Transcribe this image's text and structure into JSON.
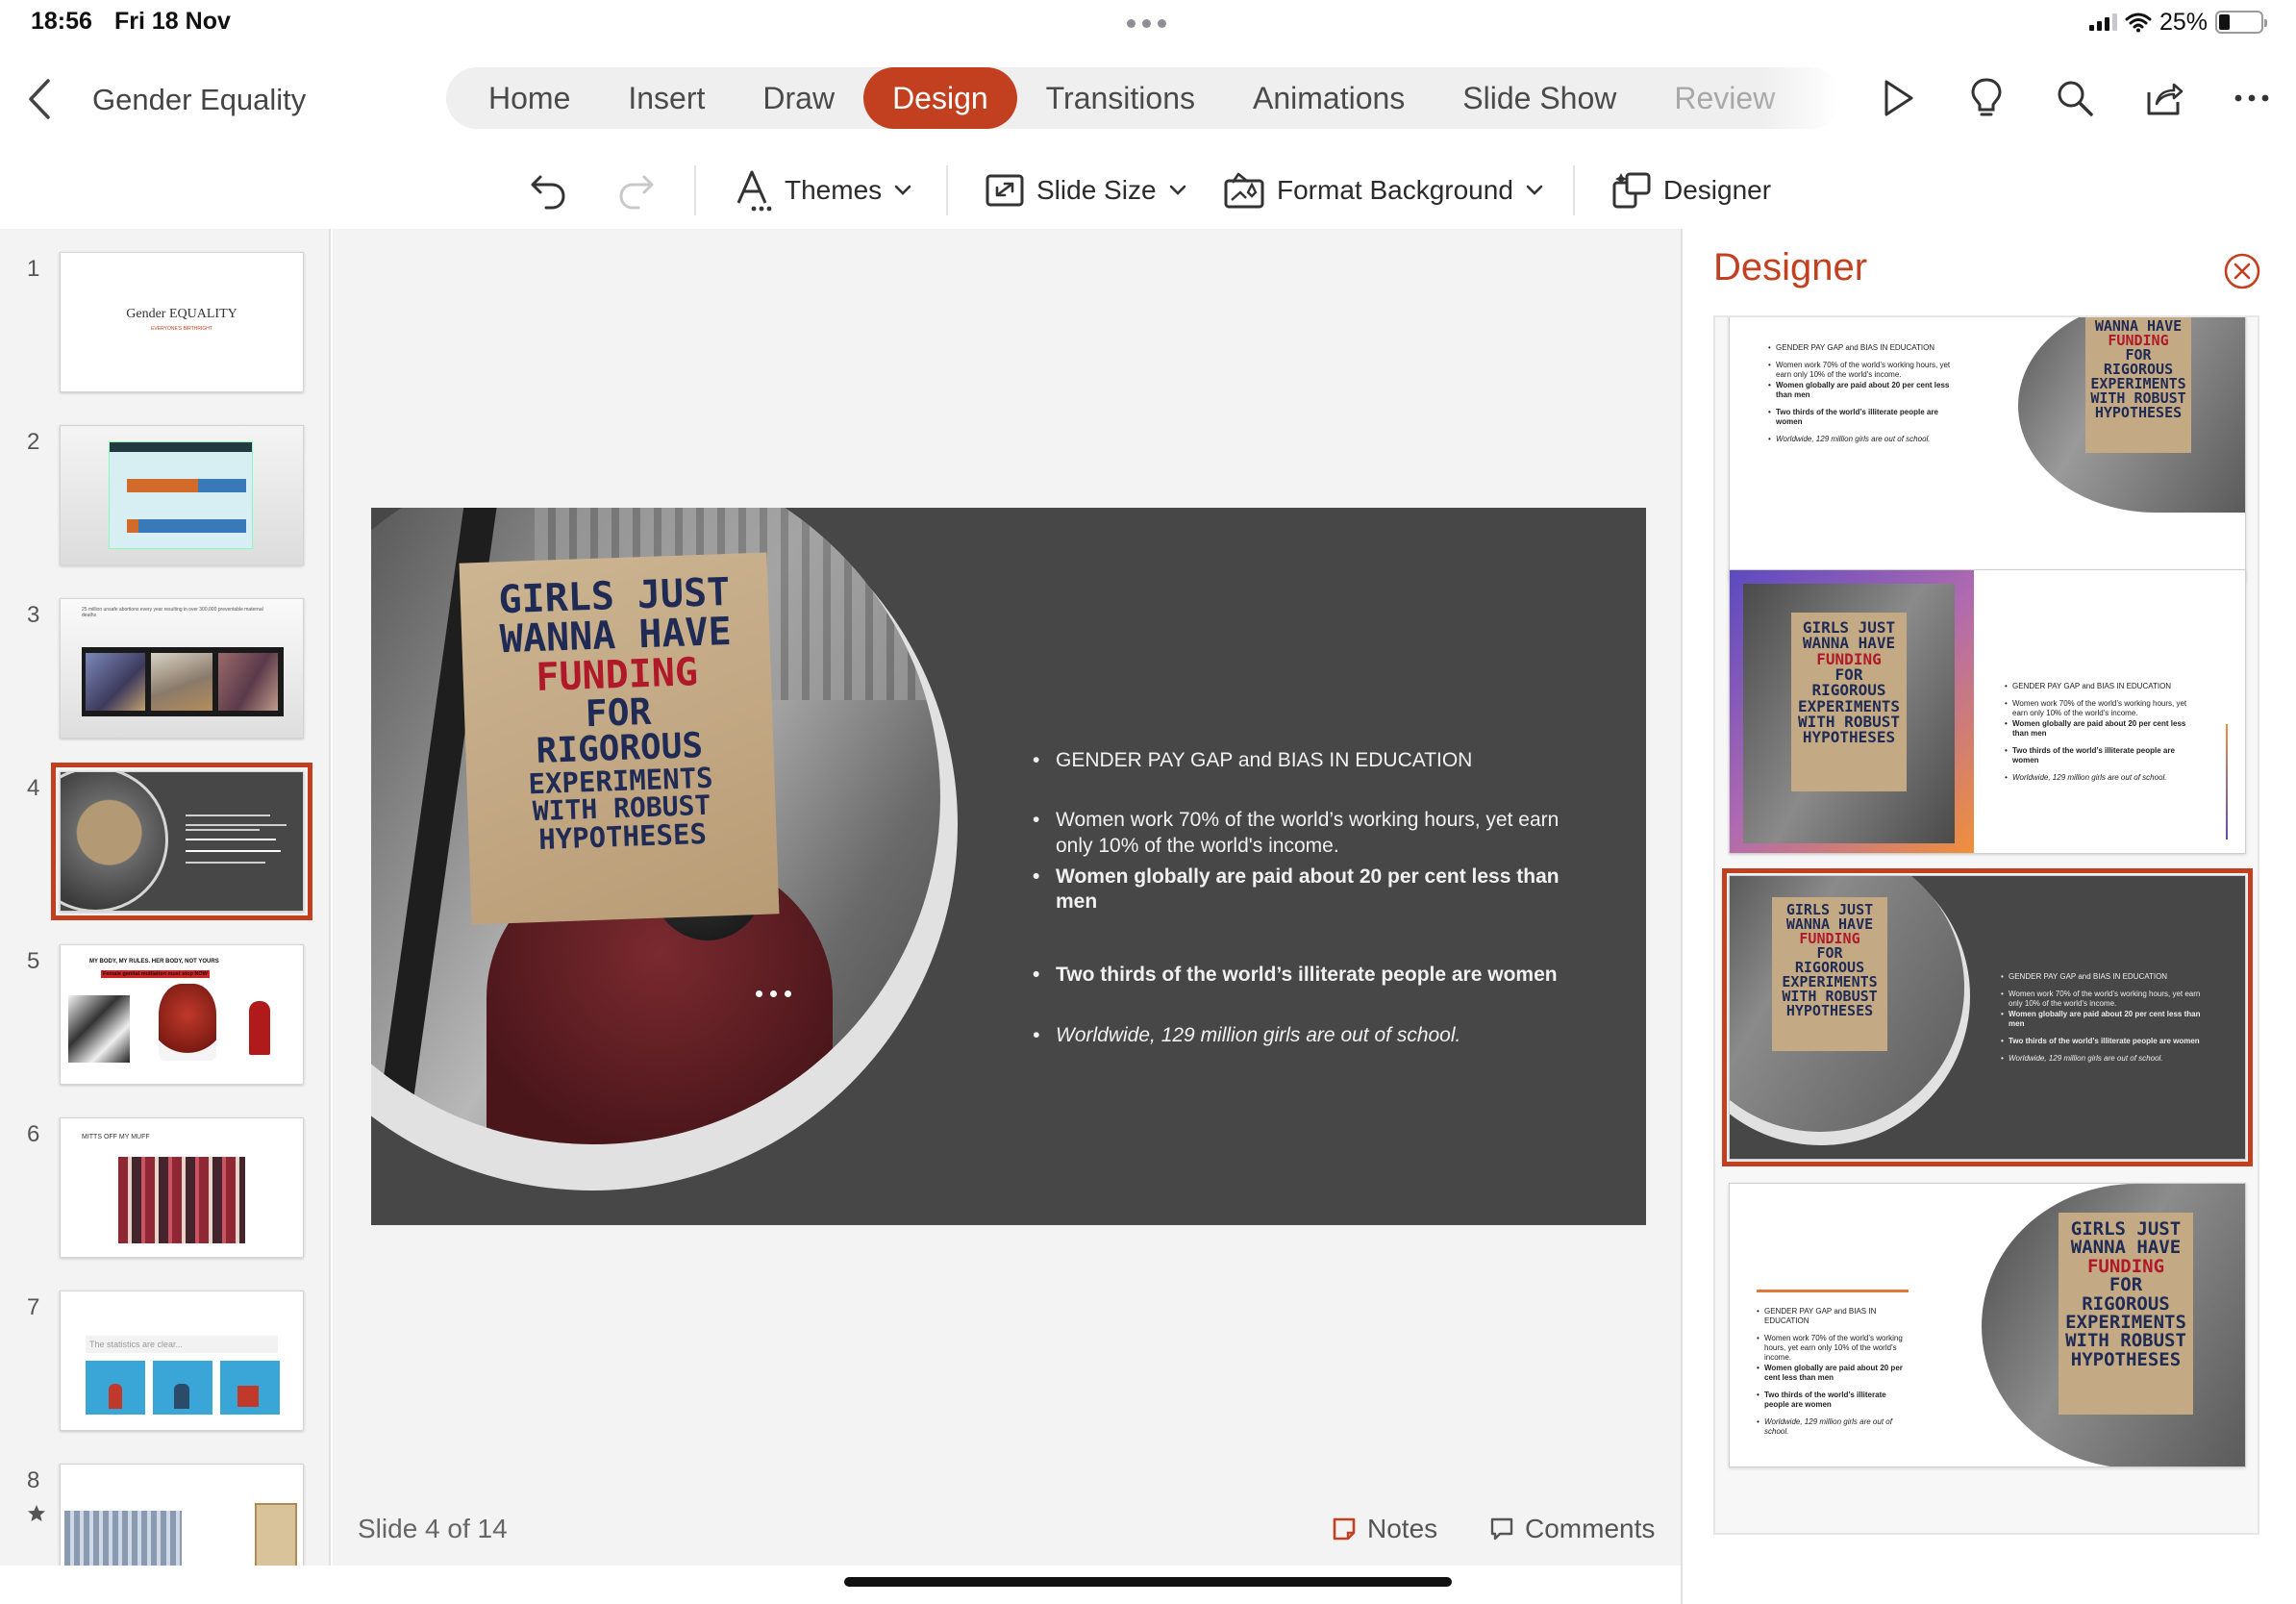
{
  "status_bar": {
    "time": "18:56",
    "date": "Fri 18 Nov",
    "battery_percent": "25%",
    "battery_level": 0.25
  },
  "topbar": {
    "back_icon": "chevron-left-icon",
    "document_title": "Gender Equality",
    "tabs": [
      {
        "label": "Home"
      },
      {
        "label": "Insert"
      },
      {
        "label": "Draw"
      },
      {
        "label": "Design"
      },
      {
        "label": "Transitions"
      },
      {
        "label": "Animations"
      },
      {
        "label": "Slide Show"
      },
      {
        "label": "Review"
      }
    ],
    "active_tab": "Design",
    "icons": [
      "play-icon",
      "lightbulb-icon",
      "search-icon",
      "share-icon",
      "more-icon"
    ]
  },
  "ribbon": {
    "undo_icon": "undo-icon",
    "redo_icon": "redo-icon",
    "themes_label": "Themes",
    "slide_size_label": "Slide Size",
    "format_background_label": "Format Background",
    "designer_label": "Designer"
  },
  "thumbnails": {
    "numbers": [
      "1",
      "2",
      "3",
      "4",
      "5",
      "6",
      "7",
      "8"
    ],
    "selected": "4",
    "slide1_title": "Gender EQUALITY",
    "slide1_subtitle": "EVERYONE'S BIRTHRIGHT",
    "slide3_caption": "25 million unsafe abortions every year resulting in over 300,000 preventable maternal deaths",
    "slide5_title": "MY BODY, MY RULES.   HER BODY, NOT YOURS",
    "slide5_subtitle": "Female genital mutilation must stop NOW",
    "slide6_title": "MITTS OFF MY MUFF",
    "slide7_title": "The statistics are clear..."
  },
  "slide": {
    "sign_lines": [
      "GIRLS JUST",
      "WANNA HAVE",
      "FUNDING",
      "FOR",
      "RIGOROUS",
      "EXPERIMENTS",
      "WITH ROBUST",
      "HYPOTHESES"
    ],
    "bullets": [
      "GENDER PAY GAP and BIAS IN EDUCATION",
      "Women work 70% of the world’s working hours, yet earn only 10% of the world's income.",
      "Women globally are paid about 20 per cent less than men",
      "Two thirds of the world’s illiterate people are women",
      "Worldwide, 129 million girls are out of school."
    ]
  },
  "footer": {
    "slide_status": "Slide 4 of 14",
    "notes_label": "Notes",
    "comments_label": "Comments"
  },
  "designer": {
    "title": "Designer",
    "close_icon": "close-circle-icon",
    "selected_card": 3
  },
  "colors": {
    "accent": "#c2401f",
    "slide_bg": "#474747",
    "pane_bg": "#f3f3f3"
  }
}
